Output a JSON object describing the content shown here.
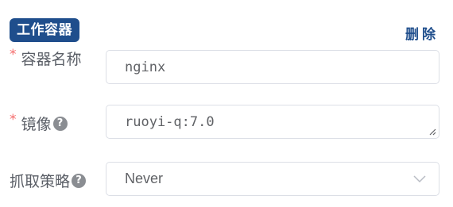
{
  "section": {
    "badge": "工作容器",
    "delete_label": "删除"
  },
  "form": {
    "name": {
      "label": "容器名称",
      "value": "nginx",
      "required_mark": "*"
    },
    "image": {
      "label": "镜像",
      "value": "ruoyi-q:7.0",
      "required_mark": "*",
      "help": "?"
    },
    "pull_policy": {
      "label": "抓取策略",
      "value": "Never",
      "help": "?"
    }
  },
  "colors": {
    "brand": "#1f4e8c",
    "required": "#f56c6c",
    "border": "#dcdfe6"
  }
}
